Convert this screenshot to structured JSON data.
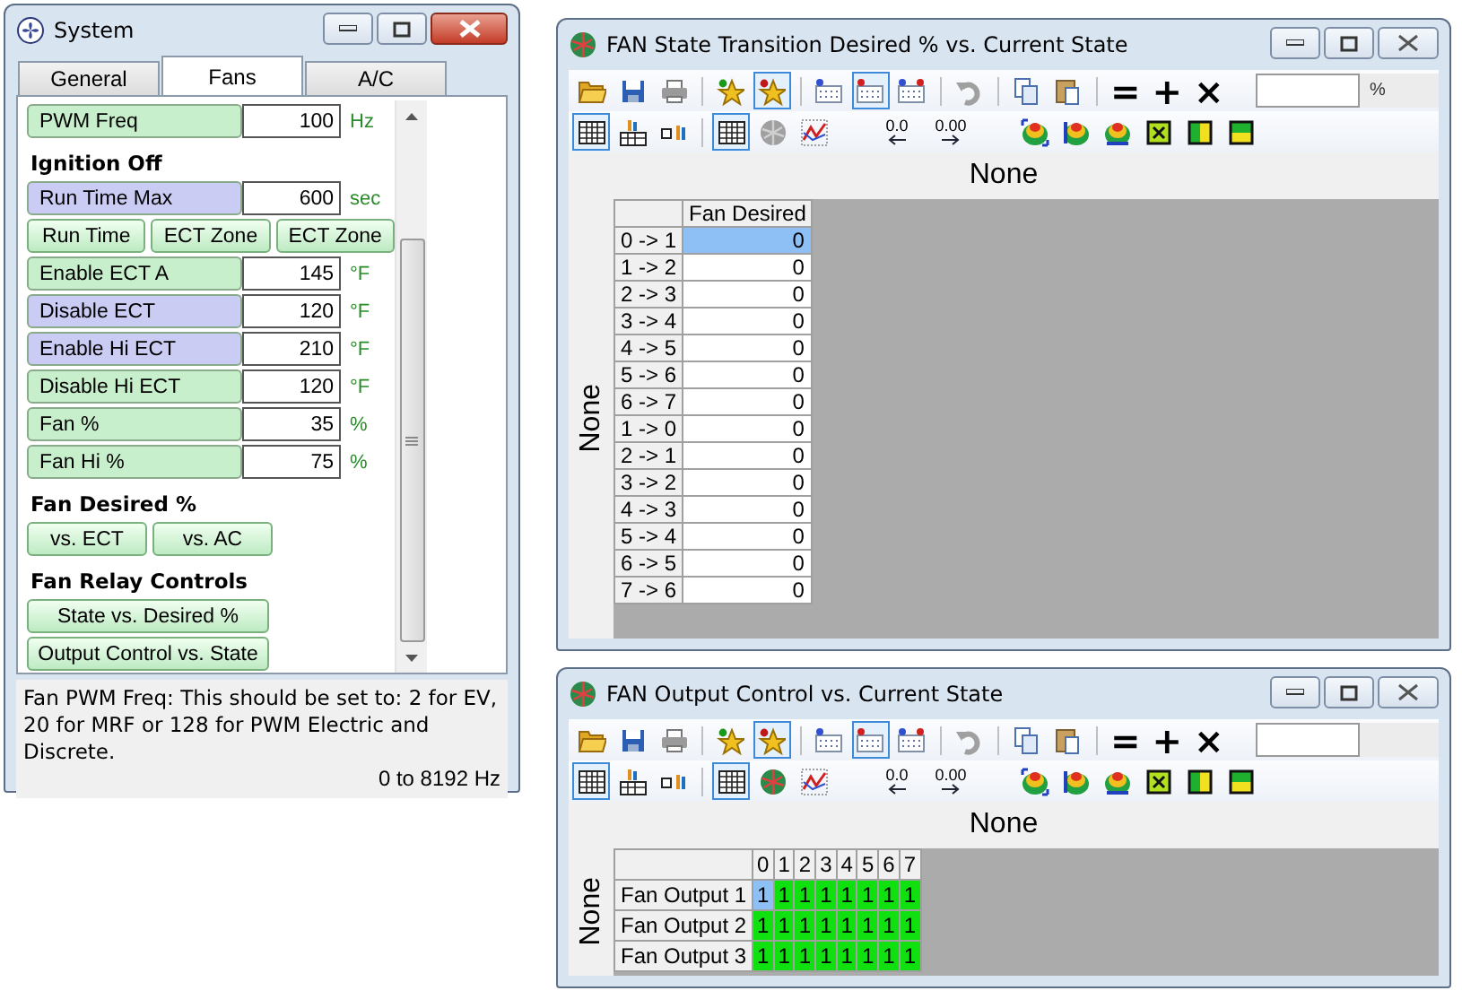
{
  "system_window": {
    "title": "System",
    "tabs": [
      {
        "label": "General",
        "selected": false
      },
      {
        "label": "Fans",
        "selected": true
      },
      {
        "label": "A/C",
        "selected": false
      }
    ],
    "items": [
      {
        "kind": "field",
        "label": "PWM Freq",
        "value": "100",
        "unit": "Hz",
        "color": "#c8efcb"
      },
      {
        "kind": "heading",
        "text": "Ignition Off"
      },
      {
        "kind": "field",
        "label": "Run Time Max",
        "value": "600",
        "unit": "sec",
        "color": "#caccf3"
      },
      {
        "kind": "buttons",
        "buttons": [
          "Run Time",
          "ECT Zone",
          "ECT Zone"
        ]
      },
      {
        "kind": "field",
        "label": "Enable ECT A",
        "value": "145",
        "unit": "°F",
        "color": "#c8efcb"
      },
      {
        "kind": "field",
        "label": "Disable ECT",
        "value": "120",
        "unit": "°F",
        "color": "#caccf3"
      },
      {
        "kind": "field",
        "label": "Enable Hi ECT",
        "value": "210",
        "unit": "°F",
        "color": "#caccf3"
      },
      {
        "kind": "field",
        "label": "Disable Hi ECT",
        "value": "120",
        "unit": "°F",
        "color": "#c8efcb"
      },
      {
        "kind": "field",
        "label": "Fan %",
        "value": "35",
        "unit": "%",
        "color": "#c8efcb"
      },
      {
        "kind": "field",
        "label": "Fan Hi %",
        "value": "75",
        "unit": "%",
        "color": "#c8efcb"
      },
      {
        "kind": "heading",
        "text": "Fan Desired %"
      },
      {
        "kind": "buttons",
        "buttons": [
          "vs. ECT",
          "vs. AC"
        ]
      },
      {
        "kind": "heading",
        "text": "Fan Relay Controls"
      },
      {
        "kind": "wide_button",
        "label": "State vs. Desired %"
      },
      {
        "kind": "wide_button",
        "label": "Output Control vs. State"
      }
    ],
    "help_text": "Fan PWM Freq: This should be set to: 2 for EV, 20 for MRF or 128 for PWM Electric and Discrete.",
    "range": "0 to 8192 Hz"
  },
  "table_windows": [
    {
      "title": "FAN State Transition Desired % vs. Current State",
      "toolbar_rows": [
        [
          {
            "kind": "folder",
            "selected": false
          },
          {
            "kind": "save",
            "selected": false
          },
          {
            "kind": "printer",
            "selected": false
          },
          {
            "kind": "separator"
          },
          {
            "kind": "star-green",
            "selected": false
          },
          {
            "kind": "star-red",
            "selected": true
          },
          {
            "kind": "separator"
          },
          {
            "kind": "grid-blue",
            "selected": false
          },
          {
            "kind": "grid-red",
            "selected": true
          },
          {
            "kind": "grid-mixed",
            "selected": false
          },
          {
            "kind": "separator"
          },
          {
            "kind": "undo",
            "selected": false
          },
          {
            "kind": "separator"
          },
          {
            "kind": "copy",
            "selected": false
          },
          {
            "kind": "paste",
            "selected": false
          },
          {
            "kind": "separator"
          },
          {
            "kind": "text",
            "label": "="
          },
          {
            "kind": "text",
            "label": "+"
          },
          {
            "kind": "text",
            "label": "×"
          }
        ],
        [
          {
            "kind": "table",
            "selected": true
          },
          {
            "kind": "table-bars",
            "selected": false
          },
          {
            "kind": "cell-bars",
            "selected": false
          },
          {
            "kind": "separator"
          },
          {
            "kind": "table",
            "selected": true
          },
          {
            "kind": "mesh",
            "selected": false
          },
          {
            "kind": "line-chart",
            "selected": false
          },
          {
            "kind": "gap"
          },
          {
            "kind": "decimal-left",
            "label": "0.0"
          },
          {
            "kind": "decimal-right",
            "label": "0.00"
          },
          {
            "kind": "gap"
          },
          {
            "kind": "surface-a",
            "selected": false
          },
          {
            "kind": "surface-b",
            "selected": false
          },
          {
            "kind": "surface-c",
            "selected": false
          },
          {
            "kind": "square-x",
            "selected": false
          },
          {
            "kind": "bar-v",
            "selected": false
          },
          {
            "kind": "bar-h",
            "selected": false
          }
        ]
      ],
      "value_field": {
        "unit": "%"
      },
      "x_title": "None",
      "y_title": "None",
      "table": {
        "kind": "numeric",
        "columns": [
          "Fan Desired"
        ],
        "rows": [
          {
            "label": "0 -> 1",
            "cells": [
              {
                "value": "0",
                "selected": true
              }
            ]
          },
          {
            "label": "1 -> 2",
            "cells": [
              {
                "value": "0",
                "selected": false
              }
            ]
          },
          {
            "label": "2 -> 3",
            "cells": [
              {
                "value": "0",
                "selected": false
              }
            ]
          },
          {
            "label": "3 -> 4",
            "cells": [
              {
                "value": "0",
                "selected": false
              }
            ]
          },
          {
            "label": "4 -> 5",
            "cells": [
              {
                "value": "0",
                "selected": false
              }
            ]
          },
          {
            "label": "5 -> 6",
            "cells": [
              {
                "value": "0",
                "selected": false
              }
            ]
          },
          {
            "label": "6 -> 7",
            "cells": [
              {
                "value": "0",
                "selected": false
              }
            ]
          },
          {
            "label": "1 -> 0",
            "cells": [
              {
                "value": "0",
                "selected": false
              }
            ]
          },
          {
            "label": "2 -> 1",
            "cells": [
              {
                "value": "0",
                "selected": false
              }
            ]
          },
          {
            "label": "3 -> 2",
            "cells": [
              {
                "value": "0",
                "selected": false
              }
            ]
          },
          {
            "label": "4 -> 3",
            "cells": [
              {
                "value": "0",
                "selected": false
              }
            ]
          },
          {
            "label": "5 -> 4",
            "cells": [
              {
                "value": "0",
                "selected": false
              }
            ]
          },
          {
            "label": "6 -> 5",
            "cells": [
              {
                "value": "0",
                "selected": false
              }
            ]
          },
          {
            "label": "7 -> 6",
            "cells": [
              {
                "value": "0",
                "selected": false
              }
            ]
          }
        ]
      }
    },
    {
      "title": "FAN Output Control vs. Current State",
      "toolbar_rows": [
        [
          {
            "kind": "folder",
            "selected": false
          },
          {
            "kind": "save",
            "selected": false
          },
          {
            "kind": "printer",
            "selected": false
          },
          {
            "kind": "separator"
          },
          {
            "kind": "star-green",
            "selected": false
          },
          {
            "kind": "star-red",
            "selected": true
          },
          {
            "kind": "separator"
          },
          {
            "kind": "grid-blue",
            "selected": false
          },
          {
            "kind": "grid-red",
            "selected": true
          },
          {
            "kind": "grid-mixed",
            "selected": false
          },
          {
            "kind": "separator"
          },
          {
            "kind": "undo",
            "selected": false
          },
          {
            "kind": "separator"
          },
          {
            "kind": "copy",
            "selected": false
          },
          {
            "kind": "paste",
            "selected": false
          },
          {
            "kind": "separator"
          },
          {
            "kind": "text",
            "label": "="
          },
          {
            "kind": "text",
            "label": "+"
          },
          {
            "kind": "text",
            "label": "×"
          }
        ],
        [
          {
            "kind": "table",
            "selected": true
          },
          {
            "kind": "table-bars",
            "selected": false
          },
          {
            "kind": "cell-bars",
            "selected": false
          },
          {
            "kind": "separator"
          },
          {
            "kind": "table",
            "selected": true
          },
          {
            "kind": "mesh-color",
            "selected": false
          },
          {
            "kind": "line-chart",
            "selected": false
          },
          {
            "kind": "gap"
          },
          {
            "kind": "decimal-left",
            "label": "0.0"
          },
          {
            "kind": "decimal-right",
            "label": "0.00"
          },
          {
            "kind": "gap"
          },
          {
            "kind": "surface-a",
            "selected": false
          },
          {
            "kind": "surface-b",
            "selected": false
          },
          {
            "kind": "surface-c",
            "selected": false
          },
          {
            "kind": "square-x",
            "selected": false
          },
          {
            "kind": "bar-v",
            "selected": false
          },
          {
            "kind": "bar-h",
            "selected": false
          }
        ]
      ],
      "x_title": "None",
      "y_title": "None",
      "table": {
        "kind": "flags",
        "columns": [
          "0",
          "1",
          "2",
          "3",
          "4",
          "5",
          "6",
          "7"
        ],
        "rows": [
          {
            "label": "Fan Output 1",
            "cells": [
              {
                "value": "1",
                "selected": true
              },
              {
                "value": "1",
                "selected": false
              },
              {
                "value": "1",
                "selected": false
              },
              {
                "value": "1",
                "selected": false
              },
              {
                "value": "1",
                "selected": false
              },
              {
                "value": "1",
                "selected": false
              },
              {
                "value": "1",
                "selected": false
              },
              {
                "value": "1",
                "selected": false
              }
            ]
          },
          {
            "label": "Fan Output 2",
            "cells": [
              {
                "value": "1",
                "selected": false
              },
              {
                "value": "1",
                "selected": false
              },
              {
                "value": "1",
                "selected": false
              },
              {
                "value": "1",
                "selected": false
              },
              {
                "value": "1",
                "selected": false
              },
              {
                "value": "1",
                "selected": false
              },
              {
                "value": "1",
                "selected": false
              },
              {
                "value": "1",
                "selected": false
              }
            ]
          },
          {
            "label": "Fan Output 3",
            "cells": [
              {
                "value": "1",
                "selected": false
              },
              {
                "value": "1",
                "selected": false
              },
              {
                "value": "1",
                "selected": false
              },
              {
                "value": "1",
                "selected": false
              },
              {
                "value": "1",
                "selected": false
              },
              {
                "value": "1",
                "selected": false
              },
              {
                "value": "1",
                "selected": false
              },
              {
                "value": "1",
                "selected": false
              }
            ]
          }
        ]
      }
    }
  ]
}
